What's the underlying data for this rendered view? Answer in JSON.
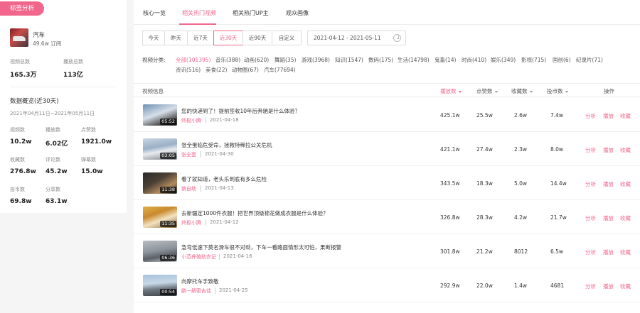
{
  "left": {
    "tag_label": "标签分析",
    "channel": {
      "name": "汽车",
      "subscribers": "49.6w 订阅"
    },
    "stats_top": [
      {
        "label": "视频总数",
        "value": "165.3万"
      },
      {
        "label": "播放总数",
        "value": "113亿"
      }
    ],
    "overview_title": "数据概览(近30天)",
    "overview_range": "2021年04月11日~2021年05月11日",
    "overview": [
      {
        "label": "视频数",
        "value": "10.2w"
      },
      {
        "label": "播放数",
        "value": "6.02亿"
      },
      {
        "label": "点赞数",
        "value": "1921.0w"
      },
      {
        "label": "收藏数",
        "value": "276.8w"
      },
      {
        "label": "评论数",
        "value": "45.2w"
      },
      {
        "label": "弹幕数",
        "value": "15.0w"
      },
      {
        "label": "投币数",
        "value": "69.8w"
      },
      {
        "label": "分享数",
        "value": "63.1w"
      }
    ]
  },
  "tabs": [
    "核心一览",
    "相关热门视频",
    "相关热门UP主",
    "观众画像"
  ],
  "active_tab": 1,
  "time_filters": [
    "今天",
    "昨天",
    "近7天",
    "近30天",
    "近90天",
    "自定义"
  ],
  "active_time": 3,
  "date_range": "2021-04-12  -  2021-05-11",
  "category_label": "视频分类:",
  "categories": [
    "全部(101395)",
    "音乐(388)",
    "动画(620)",
    "舞蹈(35)",
    "游戏(3968)",
    "知识(1547)",
    "数码(175)",
    "生活(14798)",
    "鬼畜(14)",
    "时尚(410)",
    "娱乐(349)",
    "影视(715)",
    "国创(6)",
    "纪录片(71)",
    "资讯(516)",
    "美食(22)",
    "动物圈(67)",
    "汽车(77694)"
  ],
  "table": {
    "headers": [
      "视频信息",
      "播放数",
      "点赞数",
      "收藏数",
      "投币数",
      "操作"
    ],
    "actions": [
      "分析",
      "播放",
      "收藏"
    ],
    "rows": [
      {
        "title": "您的快递到了！提前签收10年后奔驰是什么体验？",
        "author": "终极小腾",
        "date": "2021-04-18",
        "duration": "05:52",
        "plays": "425.1w",
        "likes": "25.5w",
        "favs": "2.6w",
        "coins": "7.4w"
      },
      {
        "title": "张全蛋临危受命，拯救特稀拉公关危机",
        "author": "张全蛋",
        "date": "2021-04-30",
        "duration": "03:05",
        "plays": "421.1w",
        "likes": "27.4w",
        "favs": "2.3w",
        "coins": "8.0w"
      },
      {
        "title": "看了就知道，老头乐到底有多么危险",
        "author": "狼自助",
        "date": "2021-04-13",
        "duration": "11:38",
        "plays": "343.5w",
        "likes": "18.3w",
        "favs": "5.0w",
        "coins": "14.4w"
      },
      {
        "title": "去新疆定1000件衣服！把世界顶级棉花做成衣服是什么体验？",
        "author": "终极小腾",
        "date": "2021-04-12",
        "duration": "11:35",
        "plays": "326.8w",
        "likes": "28.3w",
        "favs": "4.2w",
        "coins": "21.7w"
      },
      {
        "title": "急弯低速下莫名滑车很不对劲，下车一看路面情形太可怕，果断报警",
        "author": "小范养殖助农记",
        "date": "2021-04-16",
        "duration": "06:36",
        "plays": "301.8w",
        "likes": "21.2w",
        "favs": "8012",
        "coins": "6.5w"
      },
      {
        "title": "向摩托车手致敬",
        "author": "鹏一解密吉佳",
        "date": "2021-04-25",
        "duration": "00:54",
        "plays": "292.9w",
        "likes": "22.0w",
        "favs": "1.4w",
        "coins": "4681"
      }
    ]
  }
}
